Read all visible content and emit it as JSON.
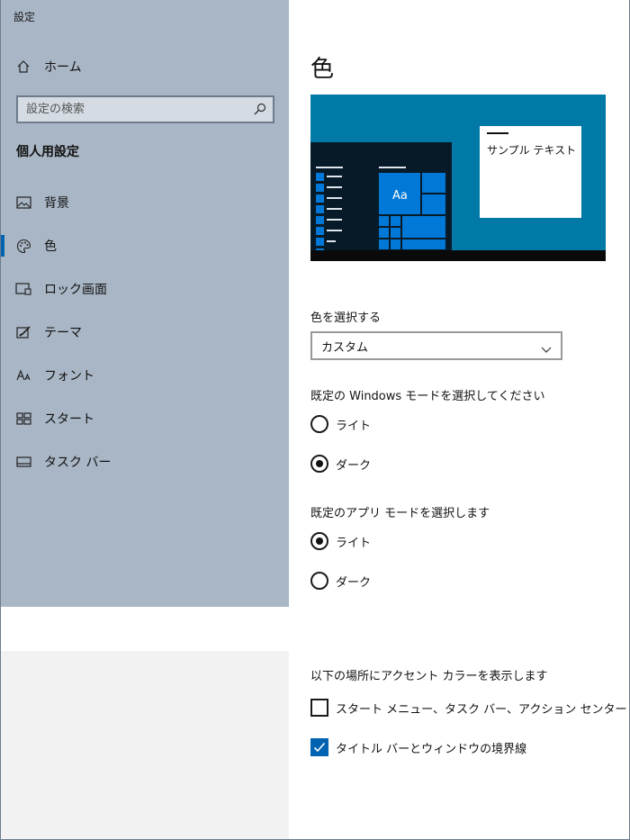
{
  "window": {
    "title": "設定"
  },
  "sidebar": {
    "home_label": "ホーム",
    "search_placeholder": "設定の検索",
    "section_title": "個人用設定",
    "items": [
      {
        "label": "背景",
        "icon": "picture-icon"
      },
      {
        "label": "色",
        "icon": "palette-icon",
        "active": true
      },
      {
        "label": "ロック画面",
        "icon": "lock-screen-icon"
      },
      {
        "label": "テーマ",
        "icon": "theme-icon"
      },
      {
        "label": "フォント",
        "icon": "font-icon"
      },
      {
        "label": "スタート",
        "icon": "start-icon"
      },
      {
        "label": "タスク バー",
        "icon": "taskbar-icon"
      }
    ]
  },
  "main": {
    "title": "色",
    "preview": {
      "sample_text": "サンプル テキスト",
      "tile_label": "Aa"
    },
    "color_select": {
      "label": "色を選択する",
      "value": "カスタム"
    },
    "windows_mode": {
      "label": "既定の Windows モードを選択してください",
      "options": [
        "ライト",
        "ダーク"
      ],
      "selected": "ダーク"
    },
    "app_mode": {
      "label": "既定のアプリ モードを選択します",
      "options": [
        "ライト",
        "ダーク"
      ],
      "selected": "ライト"
    },
    "accent": {
      "label": "以下の場所にアクセント カラーを表示します",
      "checkboxes": [
        {
          "label": "スタート メニュー、タスク バー、アクション センター",
          "checked": false
        },
        {
          "label": "タイトル バーとウィンドウの境界線",
          "checked": true
        }
      ]
    }
  },
  "colors": {
    "accent": "#0063b1",
    "sidebar_bg": "#a9b6c5",
    "preview_bg": "#0079a6"
  }
}
